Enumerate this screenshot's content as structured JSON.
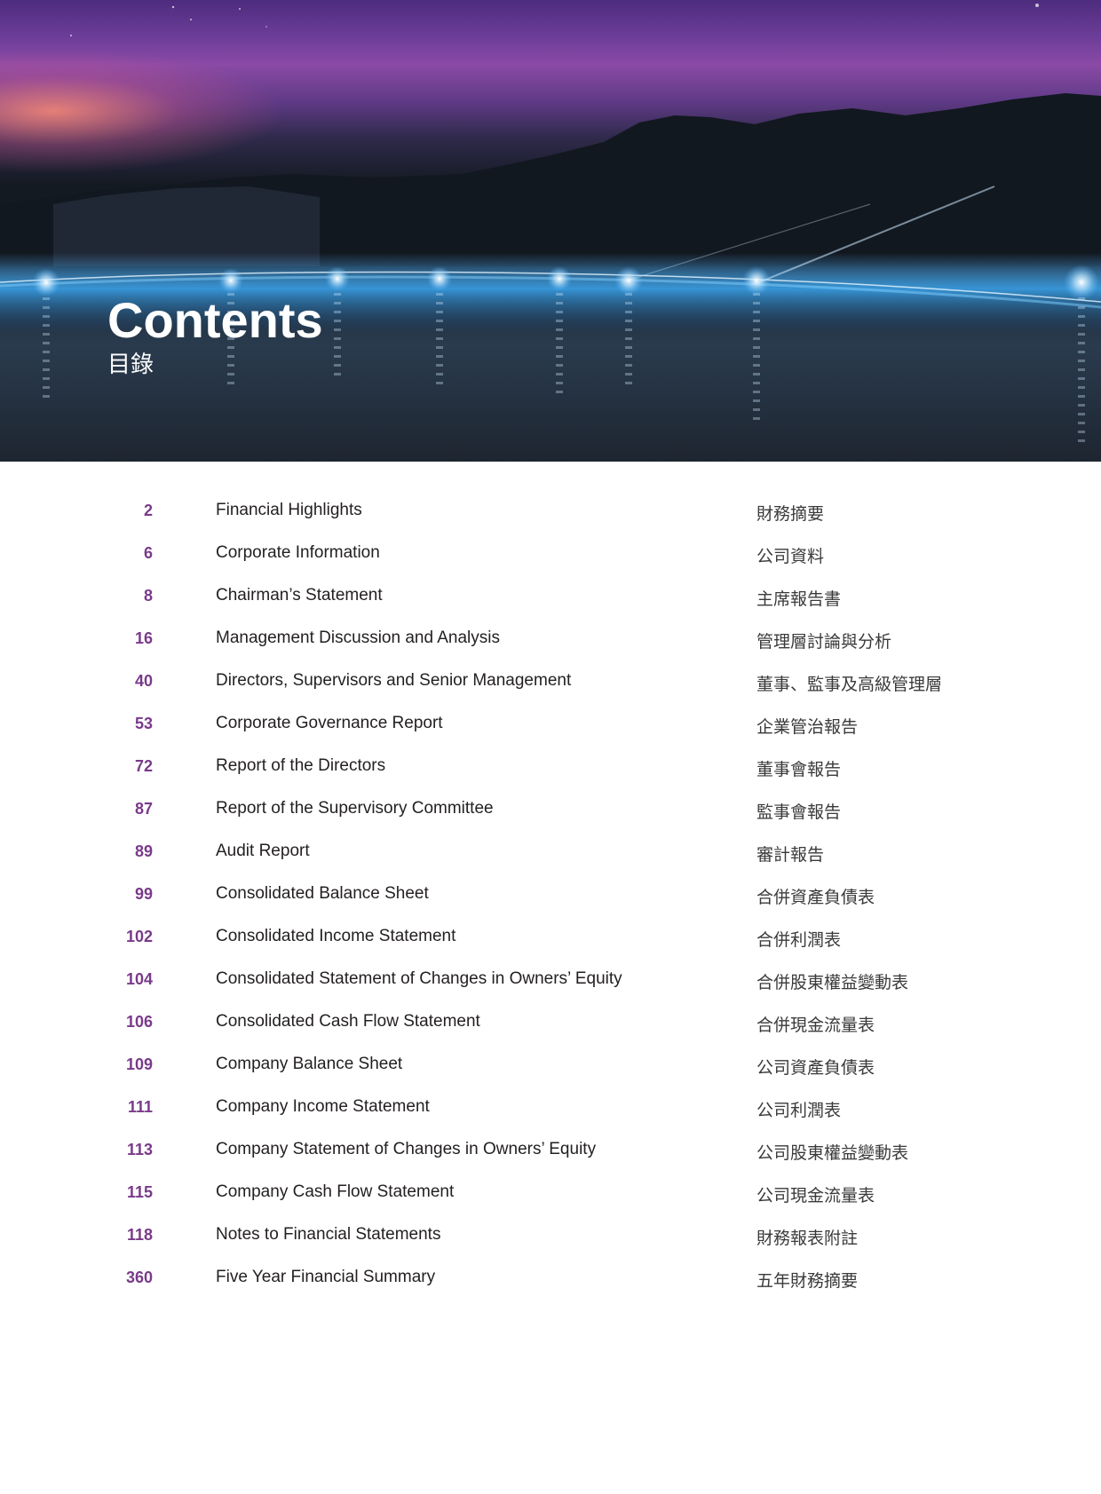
{
  "header": {
    "title": "Contents",
    "subtitle": "目錄"
  },
  "colors": {
    "page_number": "#7a3a8a",
    "text": "#231f20",
    "sky_top": "#6c3d98",
    "water_glow": "#3aa0e6"
  },
  "toc": [
    {
      "page": "2",
      "en": "Financial Highlights",
      "zh": "財務摘要"
    },
    {
      "page": "6",
      "en": "Corporate Information",
      "zh": "公司資料"
    },
    {
      "page": "8",
      "en": "Chairman’s Statement",
      "zh": "主席報告書"
    },
    {
      "page": "16",
      "en": "Management Discussion and Analysis",
      "zh": "管理層討論與分析"
    },
    {
      "page": "40",
      "en": "Directors, Supervisors and Senior Management",
      "zh": "董事、監事及高級管理層"
    },
    {
      "page": "53",
      "en": "Corporate Governance Report",
      "zh": "企業管治報告"
    },
    {
      "page": "72",
      "en": "Report of the Directors",
      "zh": "董事會報告"
    },
    {
      "page": "87",
      "en": "Report of the Supervisory Committee",
      "zh": "監事會報告"
    },
    {
      "page": "89",
      "en": "Audit Report",
      "zh": "審計報告"
    },
    {
      "page": "99",
      "en": "Consolidated Balance Sheet",
      "zh": "合併資產負債表"
    },
    {
      "page": "102",
      "en": "Consolidated Income Statement",
      "zh": "合併利潤表"
    },
    {
      "page": "104",
      "en": "Consolidated Statement of Changes in Owners’ Equity",
      "zh": "合併股東權益變動表"
    },
    {
      "page": "106",
      "en": "Consolidated Cash Flow Statement",
      "zh": "合併現金流量表"
    },
    {
      "page": "109",
      "en": "Company Balance Sheet",
      "zh": "公司資產負債表"
    },
    {
      "page": "111",
      "en": "Company Income Statement",
      "zh": "公司利潤表"
    },
    {
      "page": "113",
      "en": "Company Statement of Changes in Owners’ Equity",
      "zh": "公司股東權益變動表"
    },
    {
      "page": "115",
      "en": "Company Cash Flow Statement",
      "zh": "公司現金流量表"
    },
    {
      "page": "118",
      "en": "Notes to Financial Statements",
      "zh": "財務報表附註"
    },
    {
      "page": "360",
      "en": "Five Year Financial Summary",
      "zh": "五年財務摘要"
    }
  ]
}
